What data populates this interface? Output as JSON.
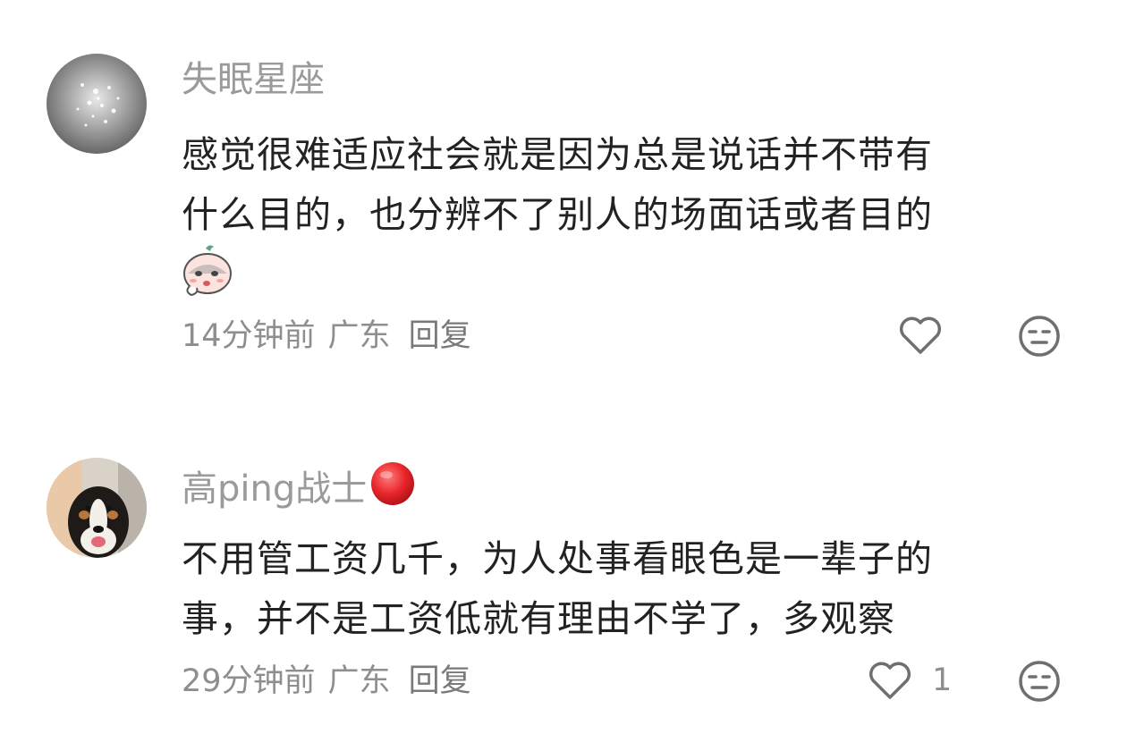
{
  "comments": [
    {
      "username": "失眠星座",
      "avatar_icon": "water-sparkle-avatar",
      "lines": [
        "感觉很难适应社会就是因为总是说话并不带有",
        "什么目的，也分辨不了别人的场面话或者目的"
      ],
      "sticker_icon": "crying-face-sticker",
      "time": "14分钟前",
      "location": "广东",
      "reply_label": "回复",
      "like_count": ""
    },
    {
      "username": "高ping战士",
      "avatar_icon": "dog-avatar",
      "badge_icon": "red-circle-emoji",
      "lines": [
        "不用管工资几千，为人处事看眼色是一辈子的",
        "事，并不是工资低就有理由不学了，多观察"
      ],
      "time": "29分钟前",
      "location": "广东",
      "reply_label": "回复",
      "like_count": "1"
    }
  ],
  "colors": {
    "username": "#9a9a9a",
    "text": "#222222",
    "meta": "#8e8e8e",
    "badge": "#e8262b"
  }
}
